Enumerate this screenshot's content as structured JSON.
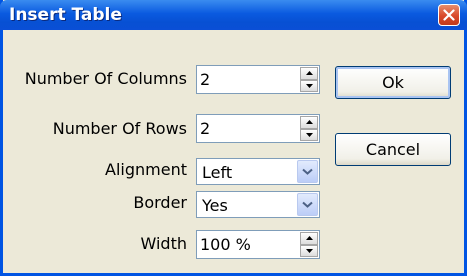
{
  "window": {
    "title": "Insert Table"
  },
  "icons": {
    "close": "close-icon",
    "spin_up": "arrow-up-icon",
    "spin_down": "arrow-down-icon",
    "dropdown": "chevron-down-icon"
  },
  "colors": {
    "titlebar": "#0a5ae0",
    "close_button": "#d9492a",
    "dialog_background": "#ece9d8",
    "field_border": "#7f9db9"
  },
  "form": {
    "columns": {
      "label": "Number Of Columns",
      "value": "2"
    },
    "rows": {
      "label": "Number Of Rows",
      "value": "2"
    },
    "alignment": {
      "label": "Alignment",
      "value": "Left"
    },
    "border": {
      "label": "Border",
      "value": "Yes"
    },
    "width": {
      "label": "Width",
      "value": "100 %"
    }
  },
  "buttons": {
    "ok": "Ok",
    "cancel": "Cancel"
  }
}
